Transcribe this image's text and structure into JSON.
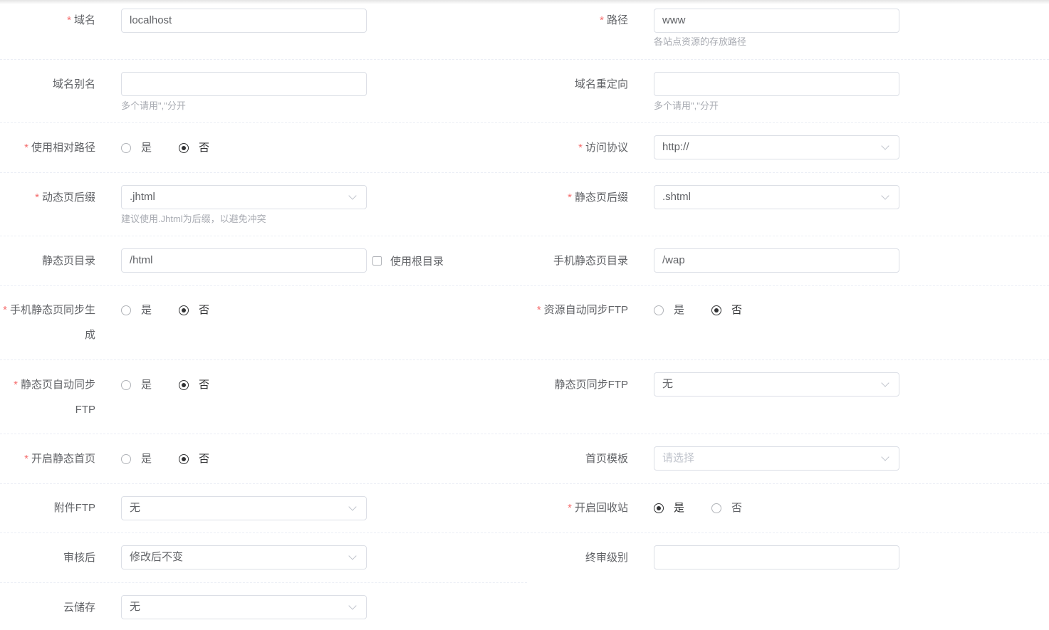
{
  "form": {
    "domain": {
      "label": "域名",
      "required": "*",
      "value": "localhost"
    },
    "path": {
      "label": "路径",
      "required": "*",
      "value": "www",
      "hint": "各站点资源的存放路径"
    },
    "alias": {
      "label": "域名别名",
      "value": "",
      "hint": "多个请用\",\"分开"
    },
    "redirect": {
      "label": "域名重定向",
      "value": "",
      "hint": "多个请用\",\"分开"
    },
    "relative_path": {
      "label": "使用相对路径",
      "required": "*",
      "options": [
        "是",
        "否"
      ],
      "selected": "否"
    },
    "protocol": {
      "label": "访问协议",
      "required": "*",
      "value": "http://"
    },
    "dynamic_suffix": {
      "label": "动态页后缀",
      "required": "*",
      "value": ".jhtml",
      "hint": "建议使用.Jhtml为后缀，以避免冲突"
    },
    "static_suffix": {
      "label": "静态页后缀",
      "required": "*",
      "value": ".shtml"
    },
    "static_dir": {
      "label": "静态页目录",
      "value": "/html",
      "checkbox_label": "使用根目录",
      "checkbox_checked": false
    },
    "mobile_static_dir": {
      "label": "手机静态页目录",
      "value": "/wap"
    },
    "mobile_sync": {
      "label_line1": "手机静态页同步生",
      "label_line2": "成",
      "required": "*",
      "options": [
        "是",
        "否"
      ],
      "selected": "否"
    },
    "resource_ftp_sync": {
      "label": "资源自动同步FTP",
      "required": "*",
      "options": [
        "是",
        "否"
      ],
      "selected": "否"
    },
    "static_auto_sync": {
      "label_line1": "静态页自动同步",
      "label_line2": "FTP",
      "required": "*",
      "options": [
        "是",
        "否"
      ],
      "selected": "否"
    },
    "static_sync_ftp": {
      "label": "静态页同步FTP",
      "value": "无"
    },
    "static_home": {
      "label": "开启静态首页",
      "required": "*",
      "options": [
        "是",
        "否"
      ],
      "selected": "否"
    },
    "home_template": {
      "label": "首页模板",
      "placeholder": "请选择"
    },
    "attach_ftp": {
      "label": "附件FTP",
      "value": "无"
    },
    "recycle_bin": {
      "label": "开启回收站",
      "required": "*",
      "options": [
        "是",
        "否"
      ],
      "selected": "是"
    },
    "after_review": {
      "label": "审核后",
      "value": "修改后不变"
    },
    "final_level": {
      "label": "终审级别",
      "value": ""
    },
    "cloud_storage": {
      "label": "云储存",
      "value": "无"
    }
  }
}
